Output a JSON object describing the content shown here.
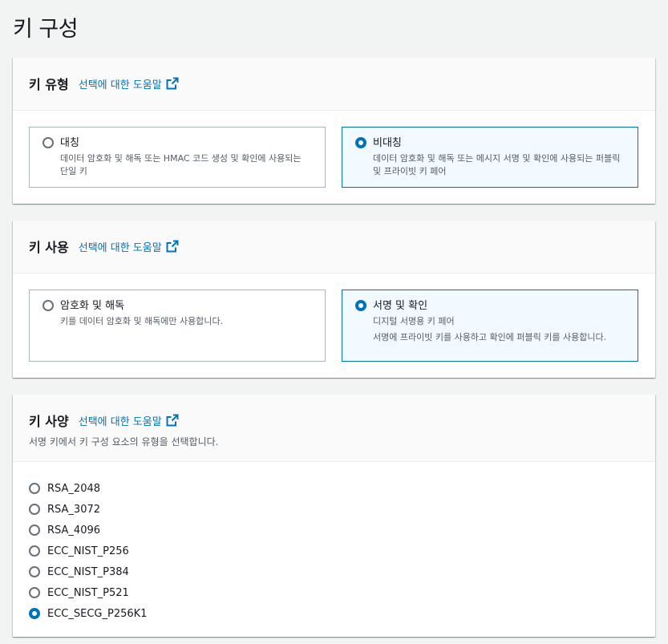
{
  "page": {
    "title": "키 구성"
  },
  "info_link": "선택에 대한 도움말",
  "key_type": {
    "title": "키 유형",
    "options": [
      {
        "label": "대칭",
        "description": "데이터 암호화 및 해독 또는 HMAC 코드 생성 및 확인에 사용되는 단일 키",
        "selected": false
      },
      {
        "label": "비대칭",
        "description": "데이터 암호화 및 해독 또는 메시지 서명 및 확인에 사용되는 퍼블릭 및 프라이빗 키 페어",
        "selected": true
      }
    ]
  },
  "key_usage": {
    "title": "키 사용",
    "options": [
      {
        "label": "암호화 및 해독",
        "description": "키를 데이터 암호화 및 해독에만 사용합니다.",
        "selected": false
      },
      {
        "label": "서명 및 확인",
        "description": "디지털 서명용 키 페어",
        "description2": "서명에 프라이빗 키를 사용하고 확인에 퍼블릭 키를 사용합니다.",
        "selected": true
      }
    ]
  },
  "key_spec": {
    "title": "키 사양",
    "description": "서명 키에서 키 구성 요소의 유형을 선택합니다.",
    "options": [
      "RSA_2048",
      "RSA_3072",
      "RSA_4096",
      "ECC_NIST_P256",
      "ECC_NIST_P384",
      "ECC_NIST_P521",
      "ECC_SECG_P256K1"
    ],
    "selected": "ECC_SECG_P256K1"
  },
  "colors": {
    "accent": "#0073bb",
    "selected_bg": "#f1faff",
    "border": "#aab7b8"
  }
}
